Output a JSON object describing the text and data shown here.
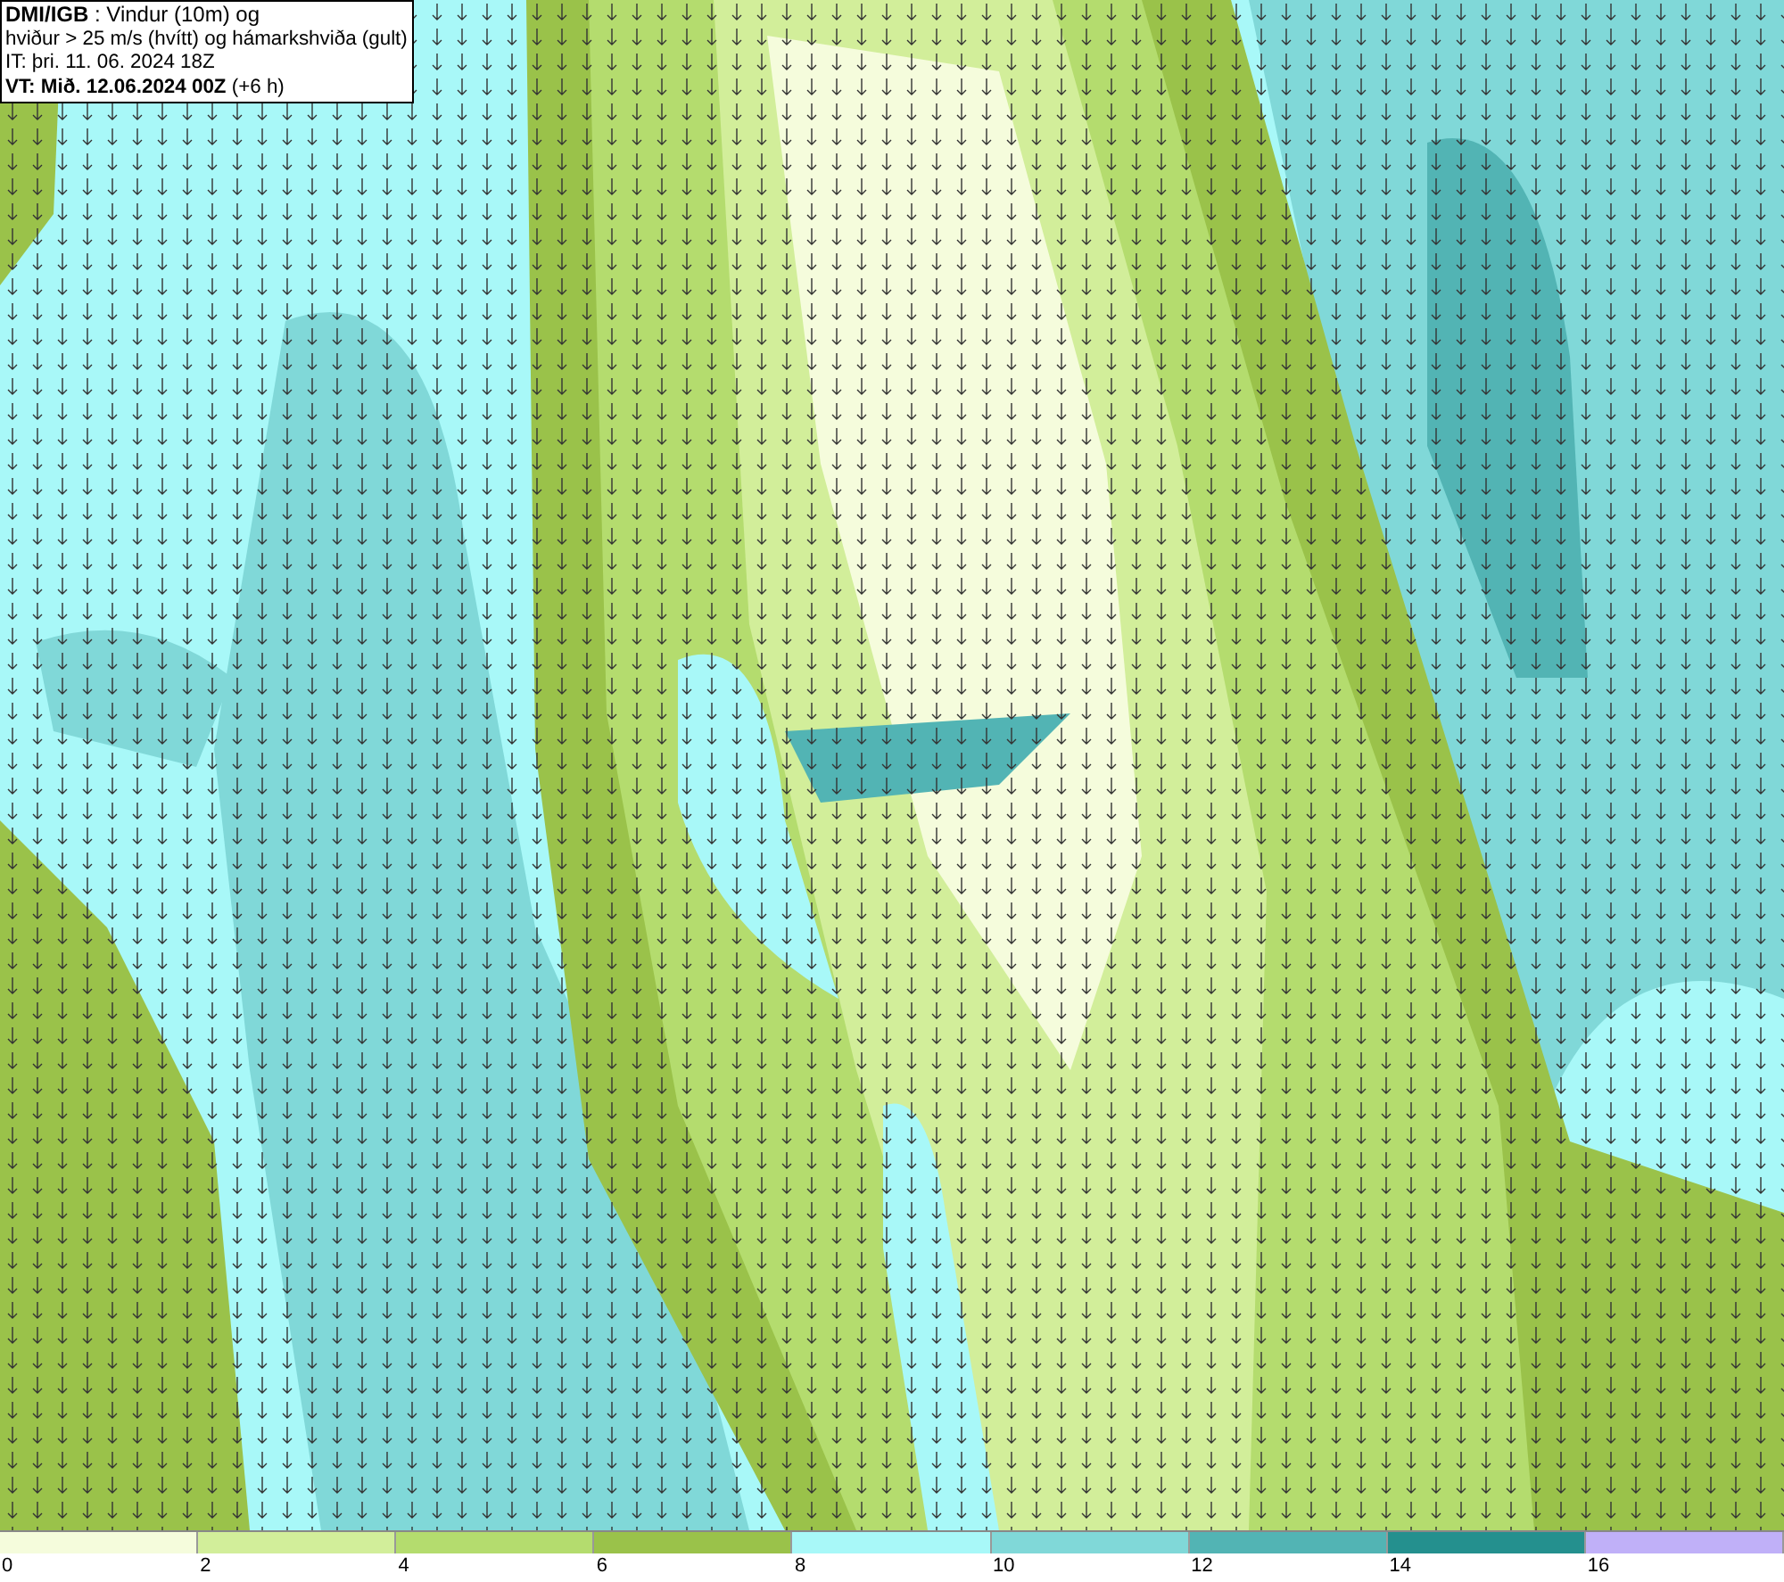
{
  "info_box": {
    "lines": [
      "**DMI/IGB** : Vindur (10m) og",
      "hviður > 25 m/s (hvítt) og hámarkshviða (gult)",
      "IT: þri. 11. 06. 2024 18Z",
      "**VT: Mið. 12.06.2024 00Z** (+6 h)"
    ]
  },
  "legend": [
    {
      "label": "0",
      "color": "#f5fcdc"
    },
    {
      "label": "2",
      "color": "#d2ee9a"
    },
    {
      "label": "4",
      "color": "#b4dc6e"
    },
    {
      "label": "6",
      "color": "#9ac24a"
    },
    {
      "label": "8",
      "color": "#a8f8f8"
    },
    {
      "label": "10",
      "color": "#80d8d8"
    },
    {
      "label": "12",
      "color": "#52b4b4"
    },
    {
      "label": "14",
      "color": "#24908e"
    },
    {
      "label": "16",
      "color": "#c0b0f8"
    }
  ]
}
